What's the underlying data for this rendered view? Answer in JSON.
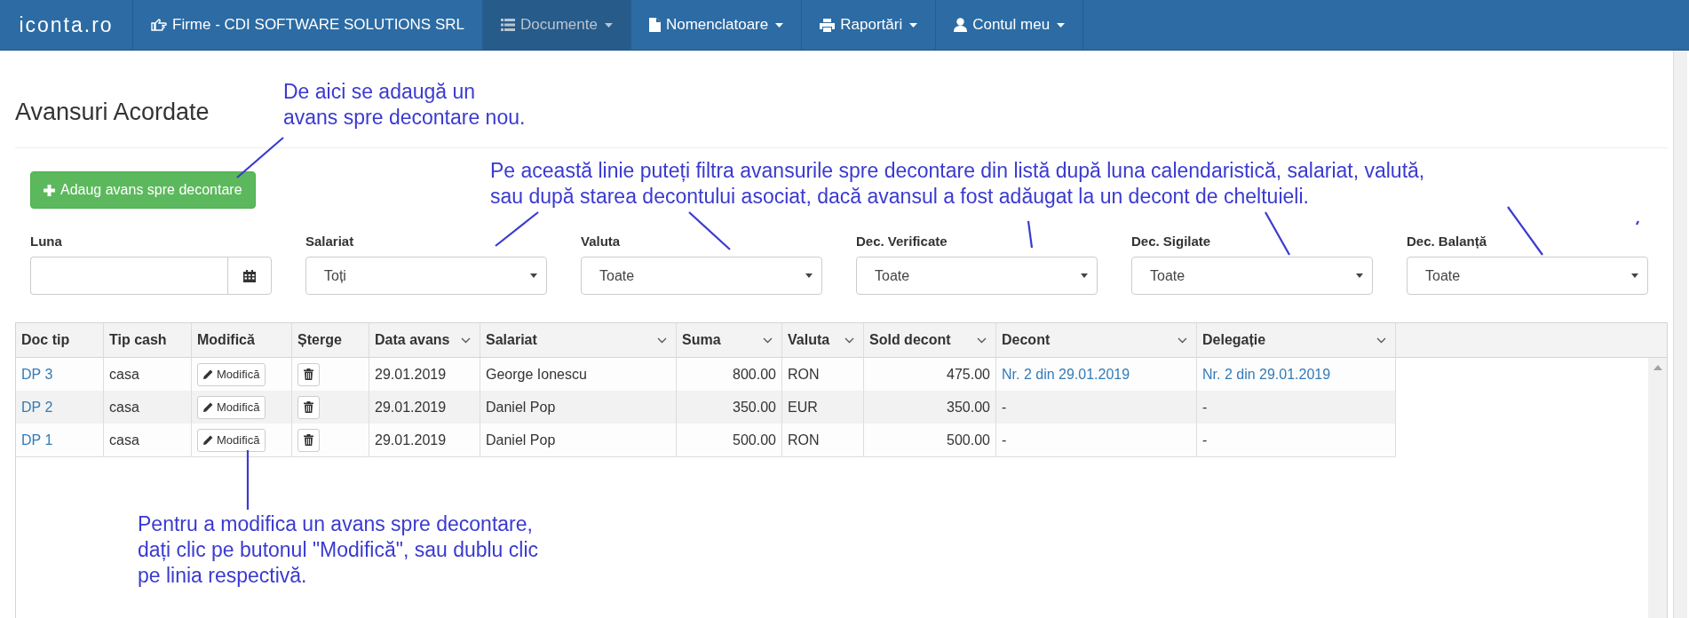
{
  "navbar": {
    "logo": "iconta.ro",
    "items": [
      {
        "label": "Firme - CDI SOFTWARE SOLUTIONS SRL",
        "selected": false,
        "dropdown": false
      },
      {
        "label": "Documente",
        "selected": true,
        "dropdown": true
      },
      {
        "label": "Nomenclatoare",
        "selected": false,
        "dropdown": true
      },
      {
        "label": "Raportări",
        "selected": false,
        "dropdown": true
      },
      {
        "label": "Contul meu",
        "selected": false,
        "dropdown": true
      }
    ]
  },
  "page_title": "Avansuri Acordate",
  "add_button": "Adaug avans spre decontare",
  "filters": [
    {
      "label": "Luna",
      "kind": "date"
    },
    {
      "label": "Salariat",
      "kind": "select",
      "value": "Toți"
    },
    {
      "label": "Valuta",
      "kind": "select",
      "value": "Toate"
    },
    {
      "label": "Dec. Verificate",
      "kind": "select",
      "value": "Toate"
    },
    {
      "label": "Dec. Sigilate",
      "kind": "select",
      "value": "Toate"
    },
    {
      "label": "Dec. Balanță",
      "kind": "select",
      "value": "Toate"
    }
  ],
  "table": {
    "columns": [
      {
        "label": "Doc tip",
        "menu": false
      },
      {
        "label": "Tip cash",
        "menu": false
      },
      {
        "label": "Modifică",
        "menu": false
      },
      {
        "label": "Șterge",
        "menu": false
      },
      {
        "label": "Data avans",
        "menu": true
      },
      {
        "label": "Salariat",
        "menu": true
      },
      {
        "label": "Suma",
        "menu": true
      },
      {
        "label": "Valuta",
        "menu": true
      },
      {
        "label": "Sold decont",
        "menu": true
      },
      {
        "label": "Decont",
        "menu": true
      },
      {
        "label": "Delegație",
        "menu": true
      }
    ],
    "rows": [
      {
        "doc_tip": "DP 3",
        "tip_cash": "casa",
        "edit": "Modifică",
        "data": "29.01.2019",
        "salariat": "George Ionescu",
        "suma": "800.00",
        "valuta": "RON",
        "sold": "475.00",
        "decont": {
          "text": "Nr. 2 din 29.01.2019",
          "link": true
        },
        "delegatie": {
          "text": "Nr. 2 din 29.01.2019",
          "link": true
        }
      },
      {
        "doc_tip": "DP 2",
        "tip_cash": "casa",
        "edit": "Modifică",
        "data": "29.01.2019",
        "salariat": "Daniel Pop",
        "suma": "350.00",
        "valuta": "EUR",
        "sold": "350.00",
        "decont": {
          "text": "-",
          "link": false
        },
        "delegatie": {
          "text": "-",
          "link": false
        }
      },
      {
        "doc_tip": "DP 1",
        "tip_cash": "casa",
        "edit": "Modifică",
        "data": "29.01.2019",
        "salariat": "Daniel Pop",
        "suma": "500.00",
        "valuta": "RON",
        "sold": "500.00",
        "decont": {
          "text": "-",
          "link": false
        },
        "delegatie": {
          "text": "-",
          "link": false
        }
      }
    ]
  },
  "annotations": [
    {
      "text": "De aici se adaugă un\navans spre decontare nou."
    },
    {
      "text": "Pe această linie puteți filtra avansurile spre decontare din listă după luna calendaristică, salariat, valută,\nsau după starea decontului asociat, dacă avansul a fost adăugat la un decont de cheltuieli."
    },
    {
      "text": "Pentru a modifica un avans spre decontare,\ndați clic pe butonul \"Modifică\", sau dublu clic\npe linia respectivă."
    }
  ]
}
